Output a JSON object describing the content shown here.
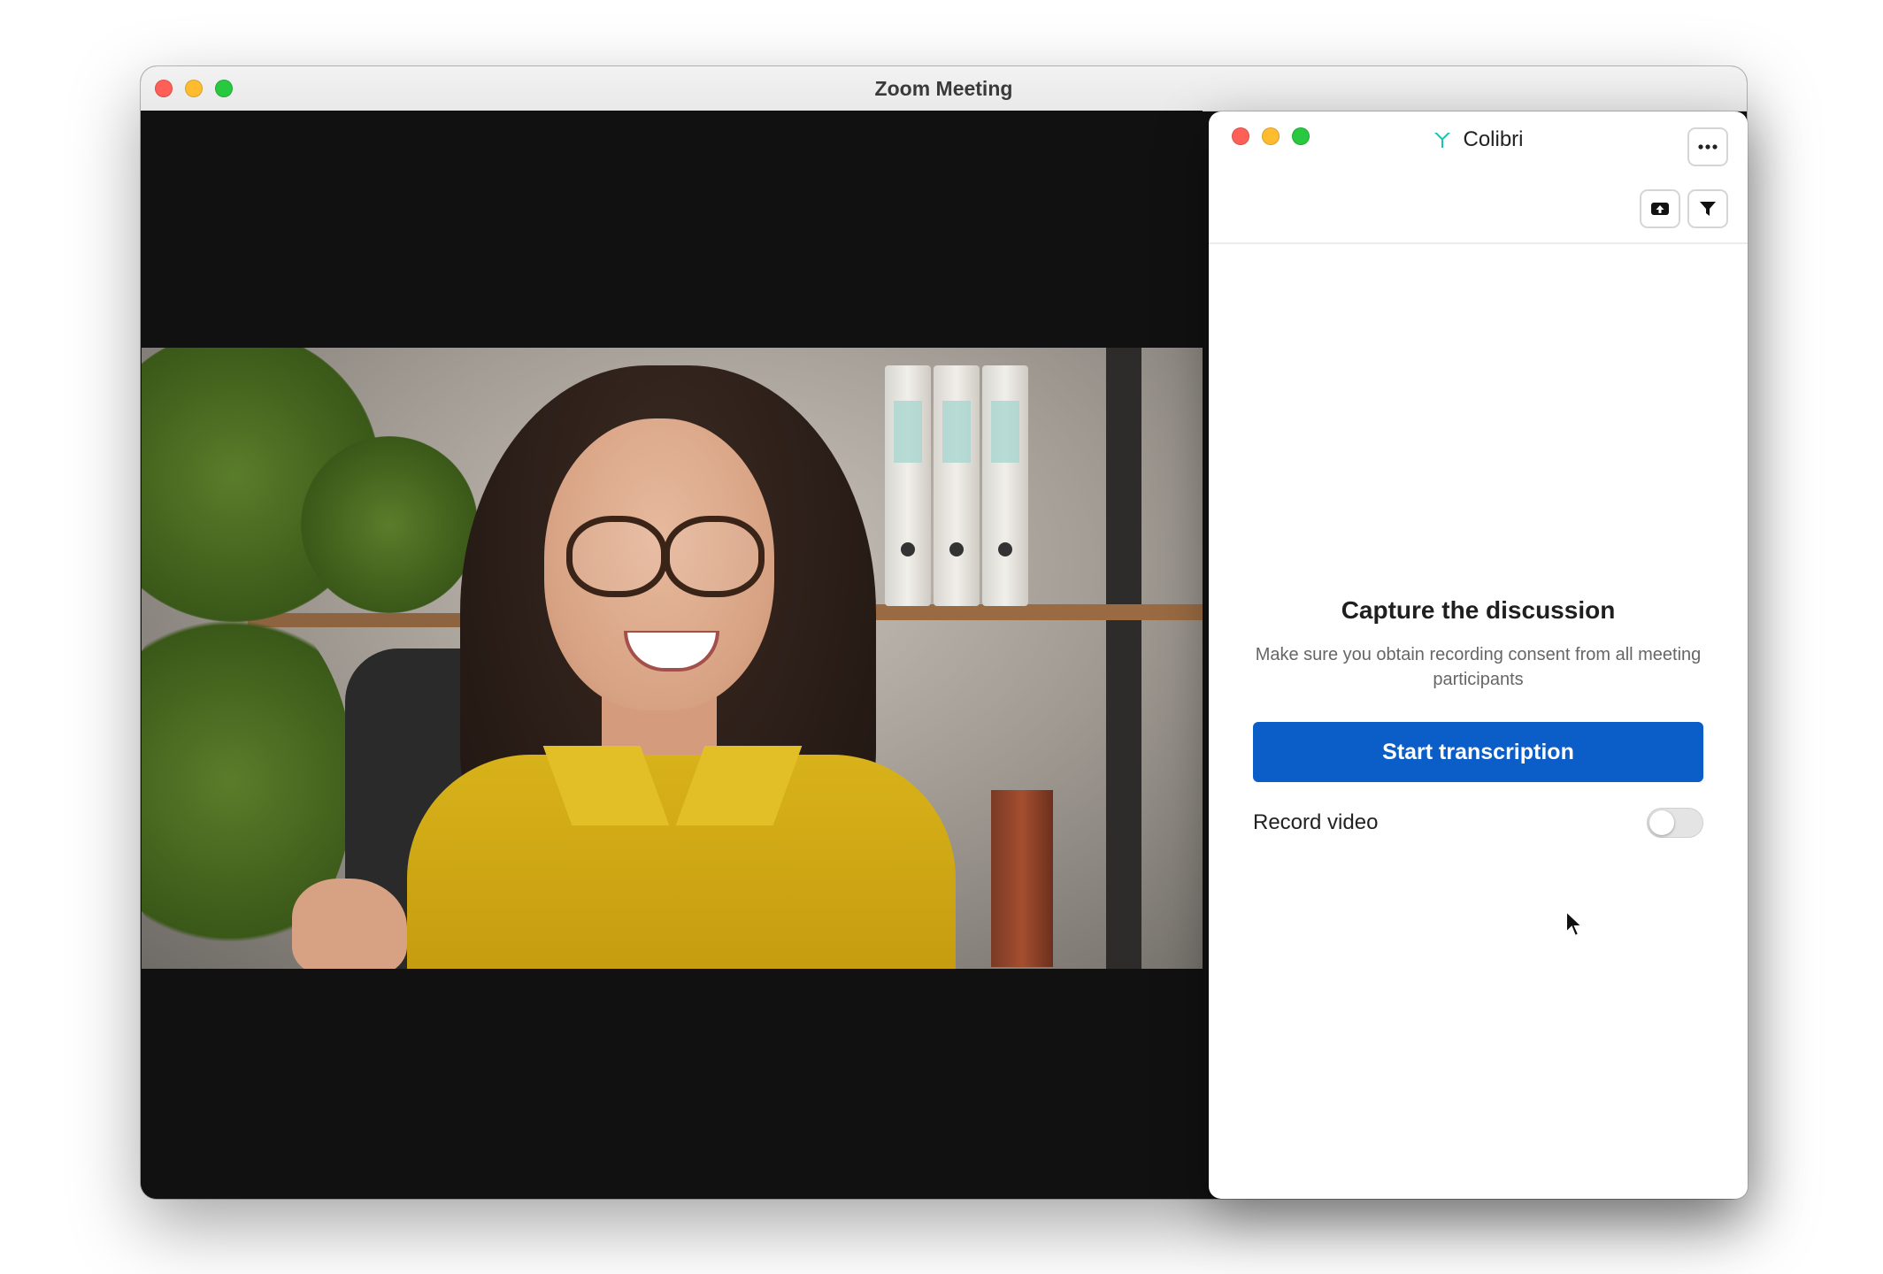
{
  "zoom_window": {
    "title": "Zoom Meeting"
  },
  "colibri": {
    "app_name": "Colibri",
    "brand_color": "#19c7b0",
    "menu_icon": "more-horizontal-icon",
    "toolbar": {
      "upload_icon": "upload-icon",
      "filter_icon": "filter-icon"
    },
    "main": {
      "heading": "Capture the discussion",
      "subtext": "Make sure you obtain recording consent from all meeting participants",
      "start_button_label": "Start transcription",
      "record_video_label": "Record video",
      "record_video_enabled": false
    }
  },
  "colors": {
    "primary_button": "#0b5dc7",
    "traffic_red": "#fe5f57",
    "traffic_yellow": "#febc2e",
    "traffic_green": "#28c840"
  }
}
